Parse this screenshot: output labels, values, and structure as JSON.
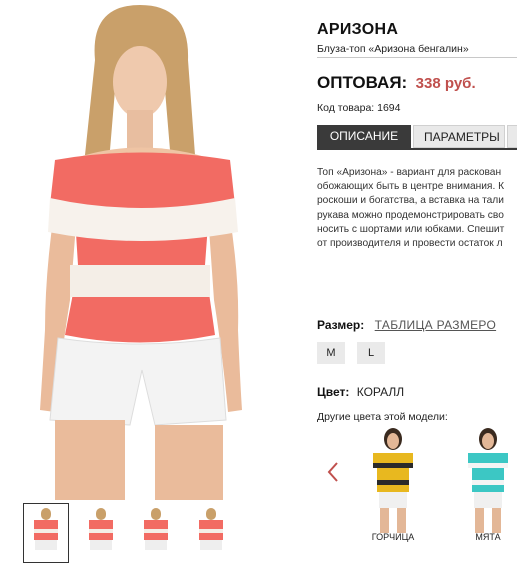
{
  "product": {
    "title": "АРИЗОНА",
    "subtitle": "Блуза-топ «Аризона бенгалин»",
    "price_label": "ОПТОВАЯ:",
    "price_value": "338 руб.",
    "sku": "Код товара: 1694"
  },
  "tabs": [
    {
      "label": "ОПИСАНИЕ",
      "active": true
    },
    {
      "label": "ПАРАМЕТРЫ",
      "active": false
    }
  ],
  "description": [
    "Топ «Аризона» - вариант для раскован",
    "обожающих быть в центре внимания. К",
    "роскоши и богатства, а вставка на тали",
    "рукава можно продемонстрировать сво",
    "носить с шортами или юбками. Спешит",
    "от производителя и провести остаток л"
  ],
  "size": {
    "label": "Размер:",
    "table_link": "ТАБЛИЦА РАЗМЕРО",
    "options": [
      "M",
      "L"
    ]
  },
  "color": {
    "label": "Цвет:",
    "value": "КОРАЛЛ",
    "other_label": "Другие цвета этой модели:",
    "variants": [
      {
        "name": "ГОРЧИЦА",
        "top_color": "#e8b81f"
      },
      {
        "name": "МЯТА",
        "top_color": "#3cc7c4"
      }
    ]
  },
  "theme": {
    "accent": "#c0504d",
    "tab_active": "#3a3a3a",
    "product_color": "#f26b63"
  }
}
